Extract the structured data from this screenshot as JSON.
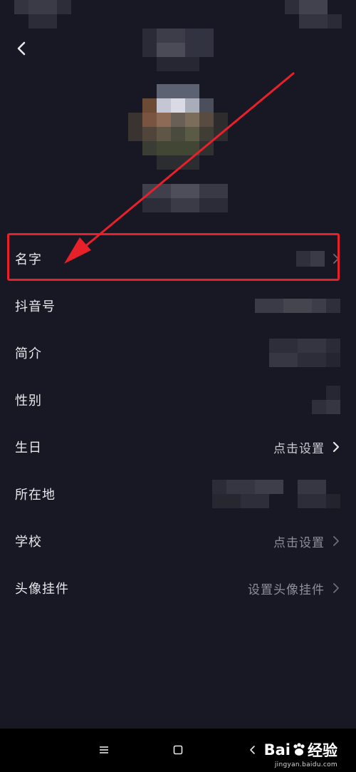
{
  "rows": [
    {
      "label": "名字",
      "value": ""
    },
    {
      "label": "抖音号",
      "value": ""
    },
    {
      "label": "简介",
      "value": ""
    },
    {
      "label": "性别",
      "value": ""
    },
    {
      "label": "生日",
      "value": "点击设置"
    },
    {
      "label": "所在地",
      "value": ""
    },
    {
      "label": "学校",
      "value": "点击设置"
    },
    {
      "label": "头像挂件",
      "value": "设置头像挂件"
    }
  ],
  "icons": {
    "back": "chevron-left-icon",
    "row_arrow": "chevron-right-icon",
    "nav_menu": "menu-icon",
    "nav_home": "square-icon",
    "nav_back": "back-icon"
  },
  "watermark": {
    "logo_text": "Bai",
    "logo_text2": "经验",
    "url": "jingyan.baidu.com"
  },
  "colors": {
    "background": "#171824",
    "highlight": "#e8202a",
    "muted_text": "#8d8f99"
  }
}
